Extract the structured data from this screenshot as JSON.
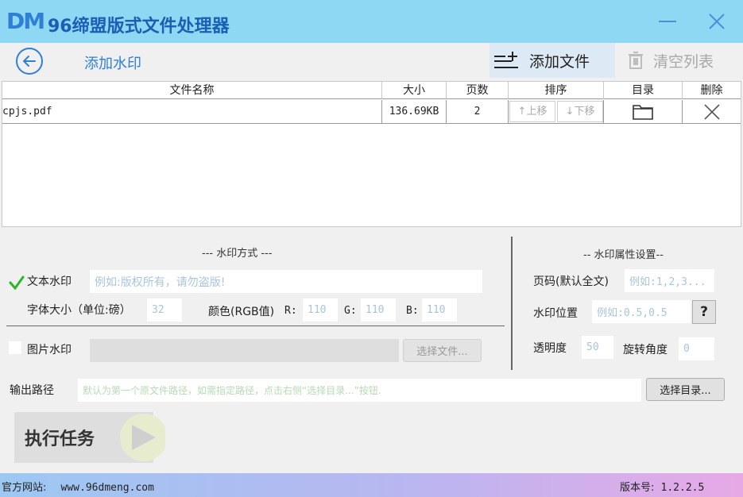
{
  "app": {
    "logo": "DM",
    "title": "96缔盟版式文件处理器"
  },
  "toolbar": {
    "page_title": "添加水印",
    "add_file": "添加文件",
    "clear_list": "清空列表"
  },
  "table": {
    "headers": [
      "文件名称",
      "大小",
      "页数",
      "排序",
      "目录",
      "删除"
    ],
    "rows": [
      {
        "name": "cpjs.pdf",
        "size": "136.69KB",
        "pages": "2",
        "up": "↑上移",
        "down": "↓下移"
      }
    ]
  },
  "watermark_mode": {
    "title": "--- 水印方式 ---",
    "text_label": "文本水印",
    "text_placeholder": "例如:版权所有，请勿盗版!",
    "font_size_label": "字体大小（单位:磅）",
    "font_size_value": "32",
    "color_label": "颜色(RGB值)",
    "r_label": "R:",
    "r_value": "110",
    "g_label": "G:",
    "g_value": "110",
    "b_label": "B:",
    "b_value": "110",
    "image_label": "图片水印",
    "choose_file": "选择文件..."
  },
  "watermark_props": {
    "title": "-- 水印属性设置--",
    "page_label": "页码(默认全文)",
    "page_placeholder": "例如:1,2,3...",
    "position_label": "水印位置",
    "position_placeholder": "例如:0.5,0.5",
    "help": "?",
    "opacity_label": "透明度",
    "opacity_value": "50",
    "rotation_label": "旋转角度",
    "rotation_value": "0"
  },
  "output": {
    "label": "输出路径",
    "placeholder": "默认为第一个原文件路径，如需指定路径，点击右侧“选择目录...”按钮.",
    "choose_dir": "选择目录..."
  },
  "run": {
    "label": "执行任务"
  },
  "status": {
    "site_label": "官方网站:",
    "site": "www.96dmeng.com",
    "version_label": "版本号:",
    "version": "1.2.2.5"
  },
  "colors": {
    "titlebar": "#8fd8f3",
    "accent": "#2f7fd4",
    "check": "#2bb52b"
  }
}
